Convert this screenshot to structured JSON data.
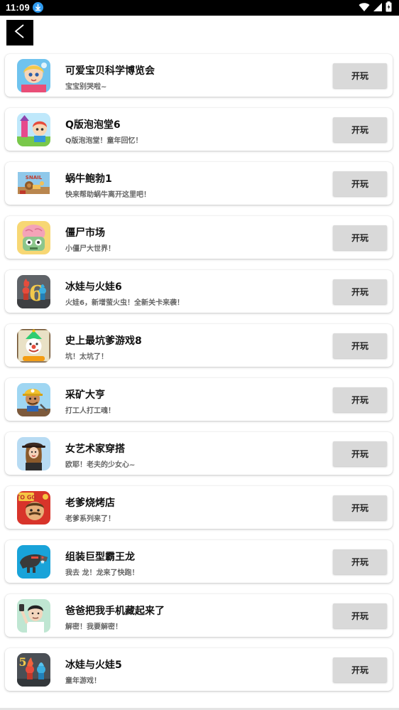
{
  "status_bar": {
    "time": "11:09",
    "icons": [
      "download-badge-icon",
      "wifi-icon",
      "signal-icon",
      "battery-icon"
    ]
  },
  "header": {
    "back_icon": "back-arrow-icon"
  },
  "colors": {
    "status_bar_bg": "#000000",
    "back_button_bg": "#000000",
    "play_button_bg": "#d9d9d9",
    "download_badge": "#2f9bf0"
  },
  "games": [
    {
      "title": "可爱宝贝科学博览会",
      "desc": "宝宝别哭啦~",
      "button": "开玩",
      "icon": "baby-science-fair-icon"
    },
    {
      "title": "Q版泡泡堂6",
      "desc": "Q版泡泡堂！童年回忆！",
      "button": "开玩",
      "icon": "bubble-hall-icon"
    },
    {
      "title": "蜗牛鲍勃1",
      "desc": "快来帮助蜗牛离开这里吧！",
      "button": "开玩",
      "icon": "snail-bob-icon"
    },
    {
      "title": "僵尸市场",
      "desc": "小僵尸大世界！",
      "button": "开玩",
      "icon": "zombie-market-icon"
    },
    {
      "title": "冰娃与火娃6",
      "desc": "火娃6，新增萤火虫！全新关卡来袭！",
      "button": "开玩",
      "icon": "fireboy-watergirl-6-icon"
    },
    {
      "title": "史上最坑爹游戏8",
      "desc": "坑！太坑了！",
      "button": "开玩",
      "icon": "clown-troll-game-icon"
    },
    {
      "title": "采矿大亨",
      "desc": "打工人打工魂！",
      "button": "开玩",
      "icon": "miner-tycoon-icon"
    },
    {
      "title": "女艺术家穿搭",
      "desc": "欧耶！老夫的少女心~",
      "button": "开玩",
      "icon": "artist-dressup-icon"
    },
    {
      "title": "老爹烧烤店",
      "desc": "老爹系列来了！",
      "button": "开玩",
      "icon": "papa-bbq-togo-icon"
    },
    {
      "title": "组装巨型霸王龙",
      "desc": "我去 龙！龙来了快跑！",
      "button": "开玩",
      "icon": "assemble-trex-icon"
    },
    {
      "title": "爸爸把我手机藏起来了",
      "desc": "解密！我要解密！",
      "button": "开玩",
      "icon": "dad-hid-phone-icon"
    },
    {
      "title": "冰娃与火娃5",
      "desc": "童年游戏！",
      "button": "开玩",
      "icon": "fireboy-watergirl-5-icon"
    }
  ]
}
